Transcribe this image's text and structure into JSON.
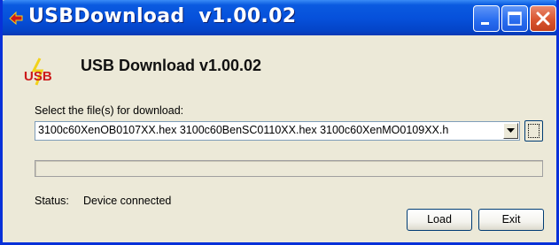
{
  "window": {
    "title": "USBDownload  v1.00.02"
  },
  "header": {
    "logo_text": "USB",
    "title": "USB Download v1.00.02"
  },
  "file_select": {
    "label": "Select the file(s) for download:",
    "value": "3100c60XenOB0107XX.hex 3100c60BenSC0110XX.hex 3100c60XenMO0109XX.h"
  },
  "progress": {
    "fraction": 0
  },
  "status": {
    "label": "Status:",
    "value": "Device connected"
  },
  "buttons": {
    "load": "Load",
    "exit": "Exit"
  },
  "colors": {
    "titlebar": "#0651db",
    "close_button": "#d9552f",
    "window_bg": "#ece9d8",
    "logo_red": "#cc1a1a",
    "logo_yellow": "#f2d21a"
  },
  "icons": {
    "app": "usb-logo-icon",
    "minimize": "minimize-icon",
    "maximize": "maximize-icon",
    "close": "close-icon",
    "dropdown": "chevron-down-icon",
    "browse": "browse-icon"
  }
}
